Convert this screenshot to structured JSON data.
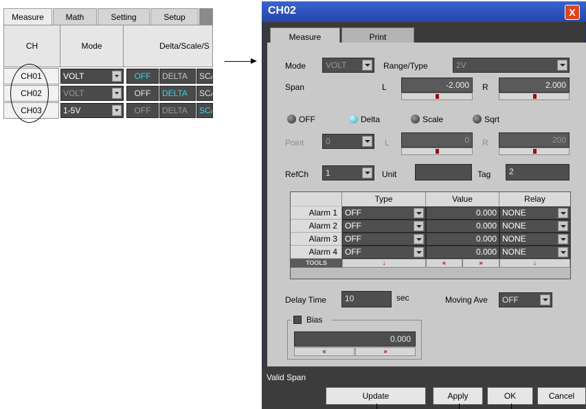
{
  "left_panel": {
    "tabs": [
      "Measure",
      "Math",
      "Setting",
      "Setup"
    ],
    "headers": {
      "ch": "CH",
      "mode": "Mode",
      "delta": "Delta/Scale/S"
    },
    "rows": [
      {
        "ch": "CH01",
        "mode": "VOLT",
        "off": "OFF",
        "delta": "DELTA",
        "scale": "SCA"
      },
      {
        "ch": "CH02",
        "mode": "VOLT",
        "off": "OFF",
        "delta": "DELTA",
        "scale": "SCA"
      },
      {
        "ch": "CH03",
        "mode": "1-5V",
        "off": "OFF",
        "delta": "DELTA",
        "scale": "SCA"
      }
    ]
  },
  "dialog": {
    "title": "CH02",
    "close_label": "X",
    "tabs": [
      "Measure",
      "Print"
    ],
    "mode_label": "Mode",
    "mode_value": "VOLT",
    "range_label": "Range/Type",
    "range_value": "2V",
    "span_label": "Span",
    "span_l_label": "L",
    "span_l_value": "-2.000",
    "span_r_label": "R",
    "span_r_value": "2.000",
    "radios": [
      "OFF",
      "Delta",
      "Scale",
      "Sqrt"
    ],
    "point_label": "Point",
    "point_value": "0",
    "point_l_label": "L",
    "point_l_value": "0",
    "point_r_label": "R",
    "point_r_value": "200",
    "refch_label": "RefCh",
    "refch_value": "1",
    "unit_label": "Unit",
    "unit_value": "",
    "tag_label": "Tag",
    "tag_value": "2",
    "alarm_headers": [
      "Type",
      "Value",
      "Relay"
    ],
    "alarms": [
      {
        "name": "Alarm 1",
        "type": "OFF",
        "value": "0.000",
        "relay": "NONE"
      },
      {
        "name": "Alarm 2",
        "type": "OFF",
        "value": "0.000",
        "relay": "NONE"
      },
      {
        "name": "Alarm 3",
        "type": "OFF",
        "value": "0.000",
        "relay": "NONE"
      },
      {
        "name": "Alarm 4",
        "type": "OFF",
        "value": "0.000",
        "relay": "NONE"
      }
    ],
    "tools_label": "TOOLS",
    "delay_label": "Delay Time",
    "delay_value": "10",
    "delay_unit": "sec",
    "moving_ave_label": "Moving Ave",
    "moving_ave_value": "OFF",
    "bias_label": "Bias",
    "bias_value": "0.000",
    "status": "Valid Span",
    "buttons": {
      "update": "Update",
      "apply": "Apply",
      "ok": "OK",
      "cancel": "Cancel"
    }
  }
}
